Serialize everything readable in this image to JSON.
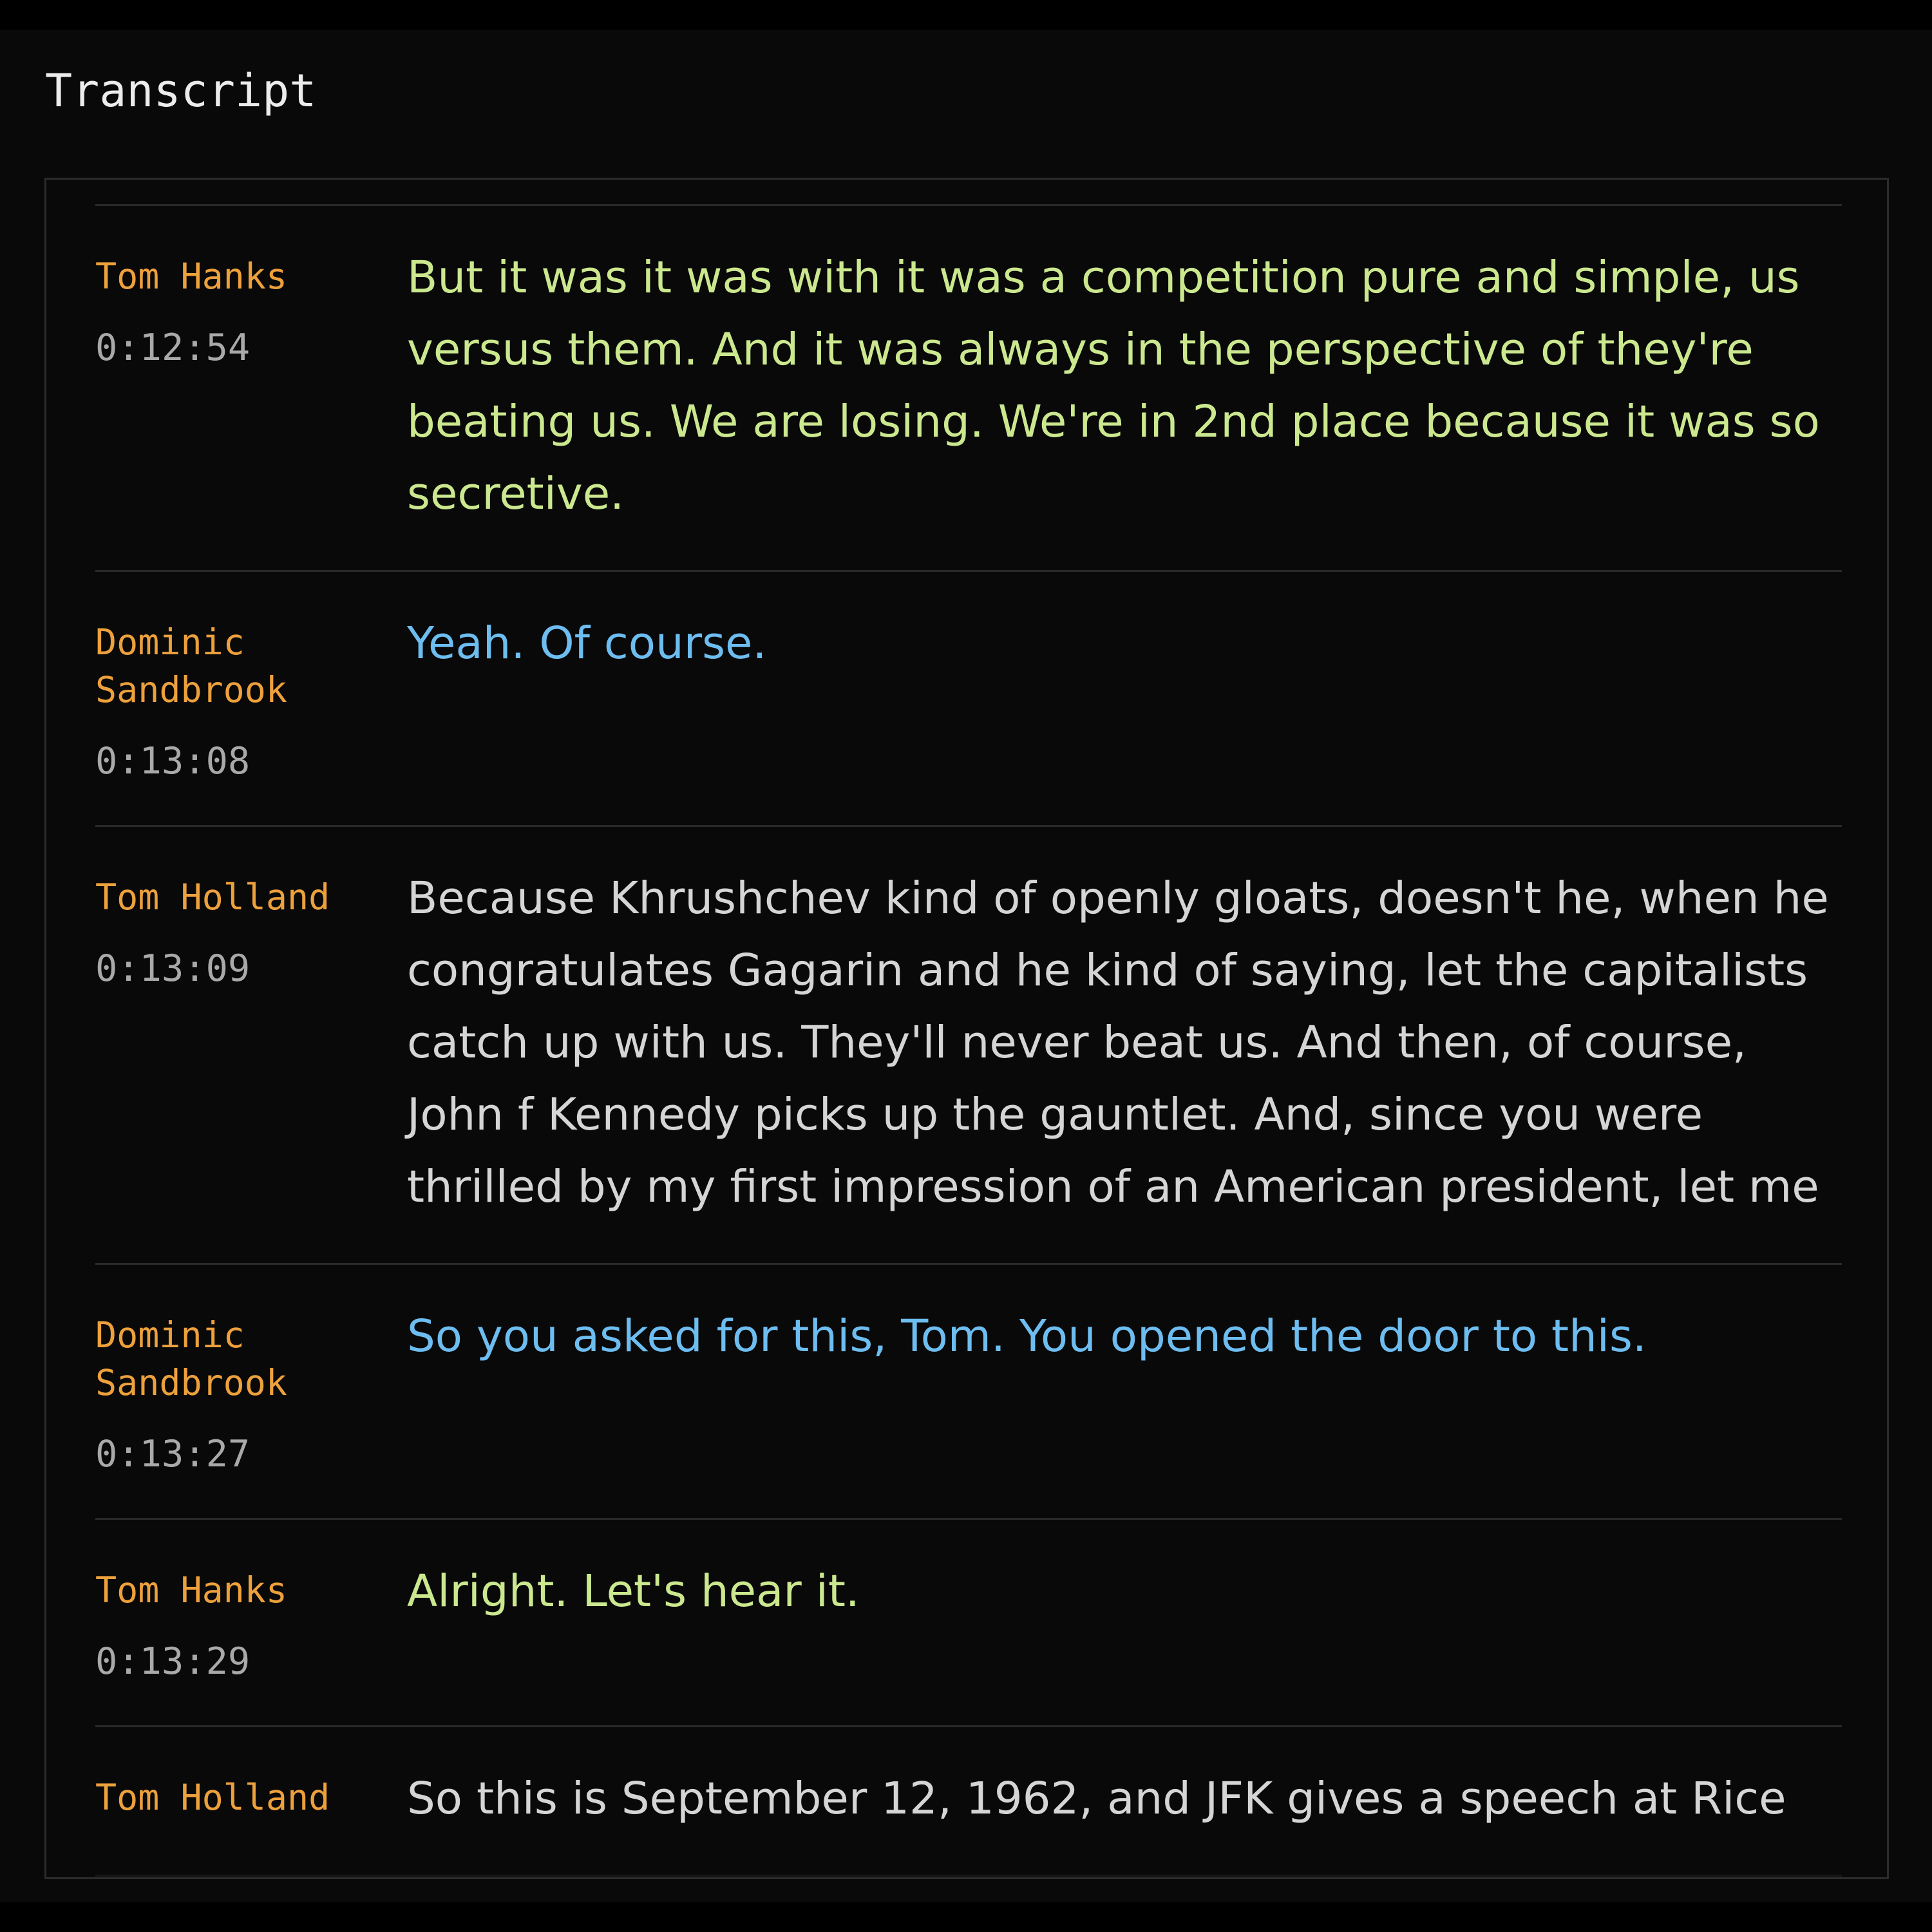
{
  "page": {
    "title": "Transcript"
  },
  "speaker_colors": {
    "Tom Hanks": "#cbe88f",
    "Dominic Sandbrook": "#6dbdf0",
    "Tom Holland": "#d5d5d5"
  },
  "colors": {
    "speaker_name": "#eda13c",
    "timestamp": "#a9a9a9",
    "background": "#0a0909",
    "divider": "#2a2a2a"
  },
  "entries": [
    {
      "speaker": "Tom Hanks",
      "time": "0:12:54",
      "text": "But it was it was with it was a competition pure and simple, us versus them.  And it was always in the perspective of they're beating us.  We are losing.  We're in 2nd place because it was so secretive."
    },
    {
      "speaker": "Dominic\nSandbrook",
      "color_key": "Dominic Sandbrook",
      "time": "0:13:08",
      "text": "Yeah.  Of course."
    },
    {
      "speaker": "Tom Holland",
      "time": "0:13:09",
      "text": "Because Khrushchev kind of openly gloats, doesn't he, when he congratulates Gagarin and he kind of saying, let the capitalists catch up with us.  They'll never beat us.  And then, of course, John f Kennedy picks up the gauntlet.  And, since you were thrilled by my first impression of an American president, let me"
    },
    {
      "speaker": "Dominic\nSandbrook",
      "color_key": "Dominic Sandbrook",
      "time": "0:13:27",
      "text": "So you asked for this, Tom.  You opened the door to this."
    },
    {
      "speaker": "Tom Hanks",
      "time": "0:13:29",
      "text": "Alright.  Let's hear it."
    },
    {
      "speaker": "Tom Holland",
      "time": "",
      "text": "So this is September 12, 1962, and JFK gives a speech at Rice"
    }
  ]
}
